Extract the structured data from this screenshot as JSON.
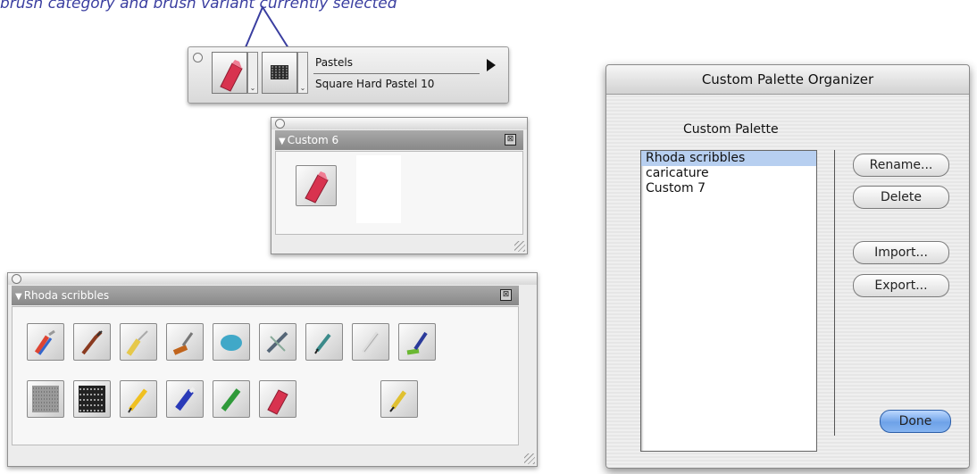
{
  "caption": {
    "text": "brush category and brush variant currently selected"
  },
  "brush_selector": {
    "category_name": "Pastels",
    "variant_name": "Square Hard Pastel 10",
    "category_icon": "pastel-stick-icon",
    "variant_icon": "dab-texture-icon",
    "menu_icon": "triangle-right-icon"
  },
  "custom_palette_small": {
    "title": "Custom  6",
    "close_glyph": "⊠",
    "items": [
      {
        "icon": "pastel-stick-icon"
      }
    ]
  },
  "rhoda_palette": {
    "title": "Rhoda scribbles",
    "close_glyph": "⊠",
    "row1": [
      "airbrush-icon",
      "oil-brush-icon",
      "palette-knife-icon",
      "acrylic-brush-icon",
      "sponge-icon",
      "cloner-icon",
      "pen-nib-icon",
      "blender-icon",
      "watercolor-brush-icon"
    ],
    "row2": [
      "noise-texture-icon",
      "grain-texture-icon",
      "pencil-icon",
      "marker-icon",
      "felt-pen-icon",
      "pastel-stick-icon",
      "fountain-pen-icon"
    ]
  },
  "dialog": {
    "title": "Custom Palette Organizer",
    "section_label": "Custom Palette",
    "list_items": [
      {
        "label": "Rhoda scribbles",
        "selected": true
      },
      {
        "label": "caricature",
        "selected": false
      },
      {
        "label": "Custom  7",
        "selected": false
      }
    ],
    "buttons": {
      "rename": "Rename...",
      "delete": "Delete",
      "import": "Import...",
      "export": "Export...",
      "done": "Done"
    }
  }
}
